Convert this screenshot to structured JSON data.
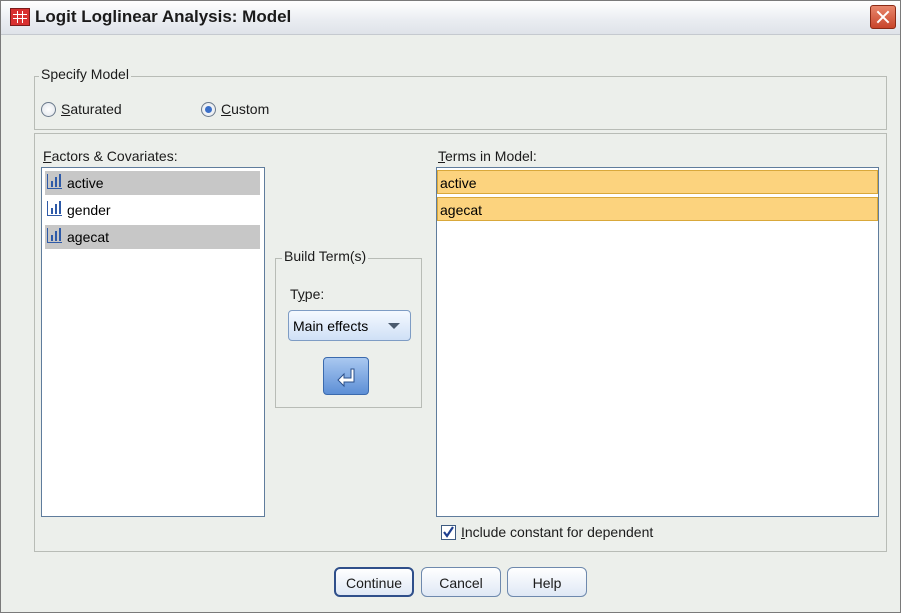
{
  "window": {
    "title": "Logit Loglinear Analysis: Model",
    "app_icon": "spss-table-icon",
    "close_icon": "close-x-icon"
  },
  "specify_model": {
    "legend": "Specify Model",
    "options": [
      {
        "label": "Saturated",
        "mnemonic": "S",
        "checked": false
      },
      {
        "label": "Custom",
        "mnemonic": "C",
        "checked": true
      }
    ]
  },
  "factors": {
    "label": "Factors & Covariates:",
    "items": [
      {
        "label": "active",
        "selected": true,
        "icon": "nominal-variable-icon"
      },
      {
        "label": "gender",
        "selected": false,
        "icon": "nominal-variable-icon"
      },
      {
        "label": "agecat",
        "selected": true,
        "icon": "nominal-variable-icon"
      }
    ]
  },
  "build_term": {
    "legend": "Build Term(s)",
    "type_label": "Type:",
    "type_value": "Main effects",
    "move_icon": "move-left-arrow-icon"
  },
  "terms": {
    "label": "Terms in Model:",
    "items": [
      "active",
      "agecat"
    ]
  },
  "include_constant": {
    "label": "Include constant for dependent",
    "checked": true
  },
  "buttons": {
    "continue": "Continue",
    "cancel": "Cancel",
    "help": "Help"
  }
}
